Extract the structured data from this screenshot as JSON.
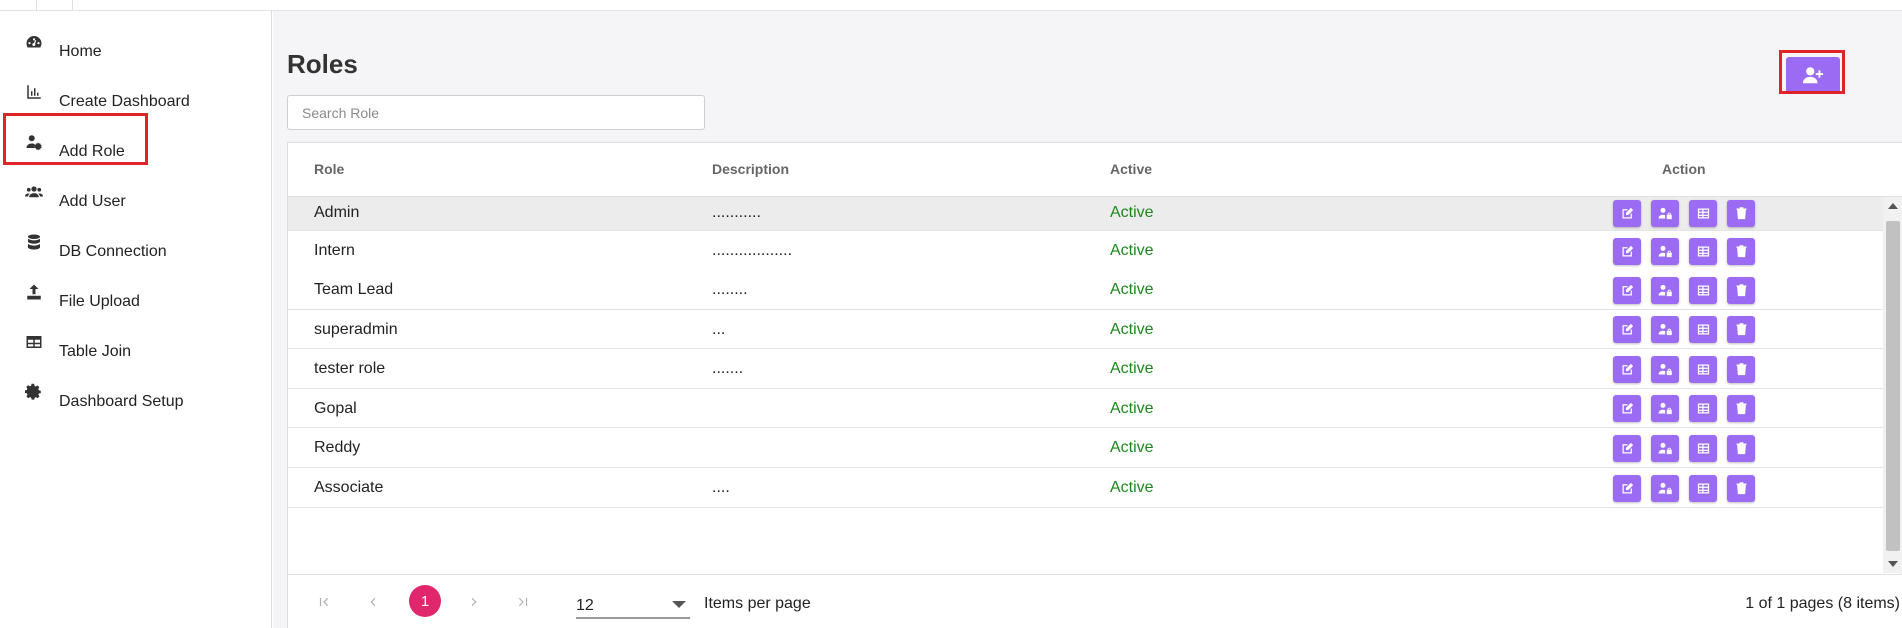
{
  "sidebar": {
    "items": [
      {
        "label": "Home",
        "icon": "dashboard-icon"
      },
      {
        "label": "Create Dashboard",
        "icon": "bar-chart-icon"
      },
      {
        "label": "Add Role",
        "icon": "user-cog-icon"
      },
      {
        "label": "Add User",
        "icon": "users-icon"
      },
      {
        "label": "DB Connection",
        "icon": "database-icon"
      },
      {
        "label": "File Upload",
        "icon": "upload-icon"
      },
      {
        "label": "Table Join",
        "icon": "table-icon"
      },
      {
        "label": "Dashboard Setup",
        "icon": "gear-icon"
      }
    ],
    "highlighted_item": "Add Role"
  },
  "main": {
    "title": "Roles",
    "search": {
      "placeholder": "Search Role",
      "value": ""
    },
    "add_button": {
      "icon": "user-plus-icon",
      "highlighted": true
    }
  },
  "grid": {
    "columns": [
      "Role",
      "Description",
      "Active",
      "Action"
    ],
    "rows": [
      {
        "role": "Admin",
        "description": "...........",
        "active": "Active",
        "selected": true
      },
      {
        "role": "Intern",
        "description": "..................",
        "active": "Active"
      },
      {
        "role": "Team Lead",
        "description": "........",
        "active": "Active"
      },
      {
        "role": "superadmin",
        "description": "...",
        "active": "Active"
      },
      {
        "role": "tester role",
        "description": ".......",
        "active": "Active"
      },
      {
        "role": "Gopal",
        "description": "",
        "active": "Active"
      },
      {
        "role": "Reddy",
        "description": "",
        "active": "Active"
      },
      {
        "role": "Associate",
        "description": "....",
        "active": "Active"
      }
    ],
    "row_actions": [
      "edit-icon",
      "user-lock-icon",
      "table-icon",
      "trash-icon"
    ]
  },
  "pager": {
    "current_page": "1",
    "page_size": "12",
    "items_per_page_label": "Items per page",
    "info": "1 of 1 pages (8 items)"
  },
  "colors": {
    "accent": "#9b6cf3",
    "active_text": "#1a8a1a",
    "current_page": "#e0276d",
    "highlight_border": "#e0222a"
  }
}
